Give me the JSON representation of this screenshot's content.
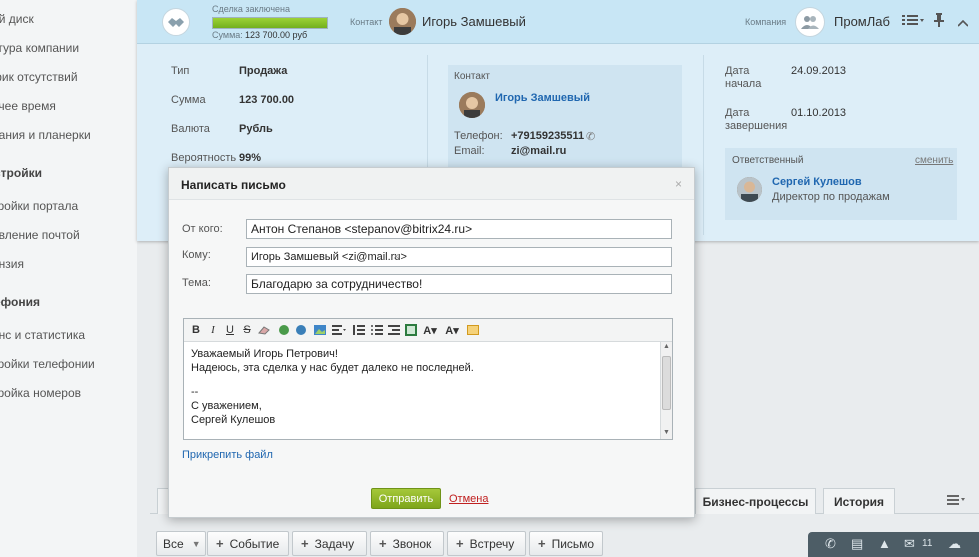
{
  "sidebar": {
    "items": [
      {
        "label": "ий диск"
      },
      {
        "label": "ктура компании"
      },
      {
        "label": "фик отсутствий"
      },
      {
        "label": "очее время"
      },
      {
        "label": "рания и планерки"
      }
    ],
    "section1": "стройки",
    "items2": [
      {
        "label": "тройки портала"
      },
      {
        "label": "авление почтой"
      },
      {
        "label": "ензия"
      }
    ],
    "section2": "ефония",
    "items3": [
      {
        "label": "анс и статистика"
      },
      {
        "label": "тройки телефонии"
      },
      {
        "label": "тройка номеров"
      }
    ]
  },
  "topbar": {
    "deal_status": "Сделка заключена",
    "progress": 1.0,
    "sum_label": "Сумма:",
    "sum_value": "123 700.00 руб",
    "contact_label": "Контакт",
    "contact_name": "Игорь Замшевый",
    "company_label": "Компания",
    "company_name": "ПромЛаб"
  },
  "details": {
    "type_label": "Тип",
    "type_value": "Продажа",
    "sum_label": "Сумма",
    "sum_value": "123 700.00",
    "currency_label": "Валюта",
    "currency_value": "Рубль",
    "prob_label": "Вероятность",
    "prob_value": "99%"
  },
  "contact": {
    "header": "Контакт",
    "name": "Игорь Замшевый",
    "phone_label": "Телефон:",
    "phone": "+79159235511",
    "email_label": "Email:",
    "email": "zi@mail.ru"
  },
  "dates": {
    "start_label_1": "Дата",
    "start_label_2": "начала",
    "start_value": "24.09.2013",
    "end_label_1": "Дата",
    "end_label_2": "завершения",
    "end_value": "01.10.2013"
  },
  "responsible": {
    "header": "Ответственный",
    "change": "сменить",
    "name": "Сергей Кулешов",
    "position": "Директор по продажам"
  },
  "tabs": [
    {
      "label": "Бизнес-процессы"
    },
    {
      "label": "История"
    }
  ],
  "actions": {
    "filter": "Все",
    "items": [
      {
        "label": "Событие"
      },
      {
        "label": "Задачу"
      },
      {
        "label": "Звонок"
      },
      {
        "label": "Встречу"
      },
      {
        "label": "Письмо"
      }
    ]
  },
  "statusbar": {
    "mail_count": "11"
  },
  "modal": {
    "title": "Написать письмо",
    "close": "×",
    "from_label": "От кого:",
    "from_value": "Антон Степанов <stepanov@bitrix24.ru>",
    "to_label": "Кому:",
    "to_value": "Игорь Замшевый <zi@mail.ru>",
    "subject_label": "Тема:",
    "subject_value": "Благодарю за сотрудничество!",
    "body": [
      "Уважаемый Игорь Петрович!",
      "Надеюсь, эта сделка у нас будет далеко не последней.",
      "",
      "--",
      "С уважением,",
      "Сергей Кулешов"
    ],
    "attach": "Прикрепить файл",
    "send": "Отправить",
    "cancel": "Отмена"
  }
}
